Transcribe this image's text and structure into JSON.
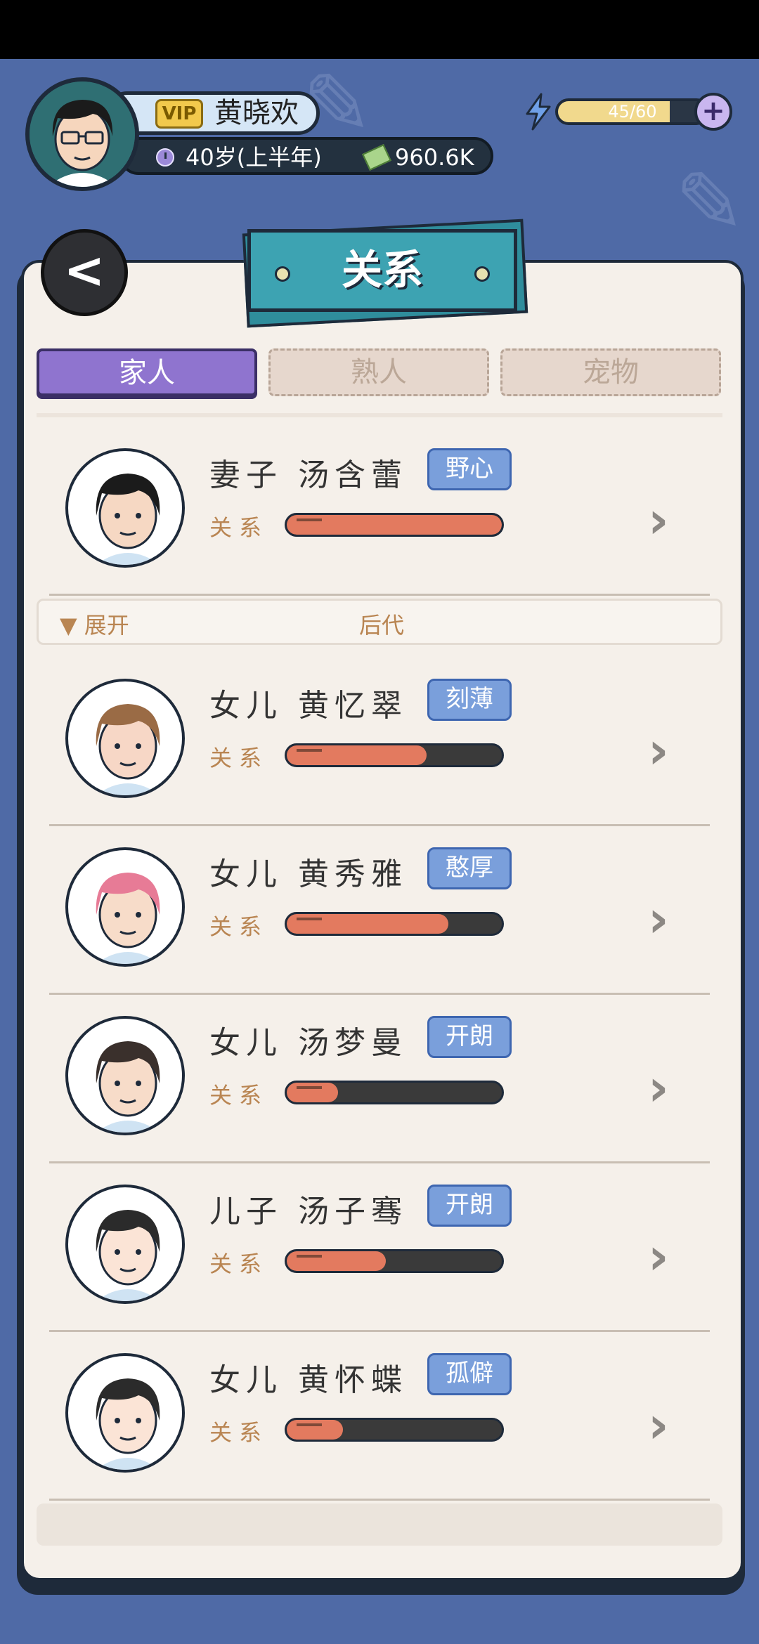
{
  "player": {
    "vip_label": "VIP",
    "name": "黄晓欢",
    "age": "40岁(上半年)",
    "money": "960.6K"
  },
  "energy": {
    "text": "45/60",
    "fraction": 0.75,
    "plus": "+"
  },
  "title": "关系",
  "back_label": "<",
  "tabs": [
    {
      "label": "家人"
    },
    {
      "label": "熟人"
    },
    {
      "label": "宠物"
    }
  ],
  "relation_label": "关系",
  "expand": {
    "label": "▼ 展开",
    "section": "后代"
  },
  "members": [
    {
      "role": "妻子",
      "name": "汤含蕾",
      "trait": "野心",
      "relation": 1.0,
      "hair": "#1b1b1b",
      "skin": "#f6d8c3"
    },
    {
      "role": "女儿",
      "name": "黄忆翠",
      "trait": "刻薄",
      "relation": 0.65,
      "hair": "#9a6b45",
      "skin": "#f7d7c6"
    },
    {
      "role": "女儿",
      "name": "黄秀雅",
      "trait": "憨厚",
      "relation": 0.75,
      "hair": "#e77b96",
      "skin": "#f7dcc9"
    },
    {
      "role": "女儿",
      "name": "汤梦曼",
      "trait": "开朗",
      "relation": 0.24,
      "hair": "#3a302c",
      "skin": "#f7dcc9"
    },
    {
      "role": "儿子",
      "name": "汤子骞",
      "trait": "开朗",
      "relation": 0.46,
      "hair": "#2b2b2b",
      "skin": "#fbe4d6"
    },
    {
      "role": "女儿",
      "name": "黄怀蝶",
      "trait": "孤僻",
      "relation": 0.26,
      "hair": "#2b2b2b",
      "skin": "#fbe4d6"
    }
  ]
}
